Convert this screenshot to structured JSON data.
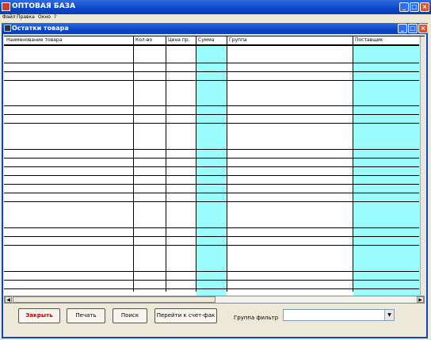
{
  "app": {
    "title": "ОПТОВАЯ БАЗА",
    "menu": [
      "Файл",
      "Правка",
      "Окно",
      "?"
    ]
  },
  "window": {
    "title": "Остатки товара"
  },
  "grid": {
    "columns": [
      "Наименование товара",
      "Кол-во",
      "Цена пр.",
      "Сумма",
      "Группа",
      "Поставщик"
    ],
    "highlight_color": "#9bfdfb"
  },
  "buttons": {
    "close": "Закрыть",
    "print": "Печать",
    "search": "Поиск",
    "goto_invoice": "Перейти к счет-фак"
  },
  "filter": {
    "label": "Группа фильтр",
    "value": ""
  },
  "icons": {
    "minimize": "minimize-icon",
    "maximize": "maximize-icon",
    "close": "close-icon"
  }
}
